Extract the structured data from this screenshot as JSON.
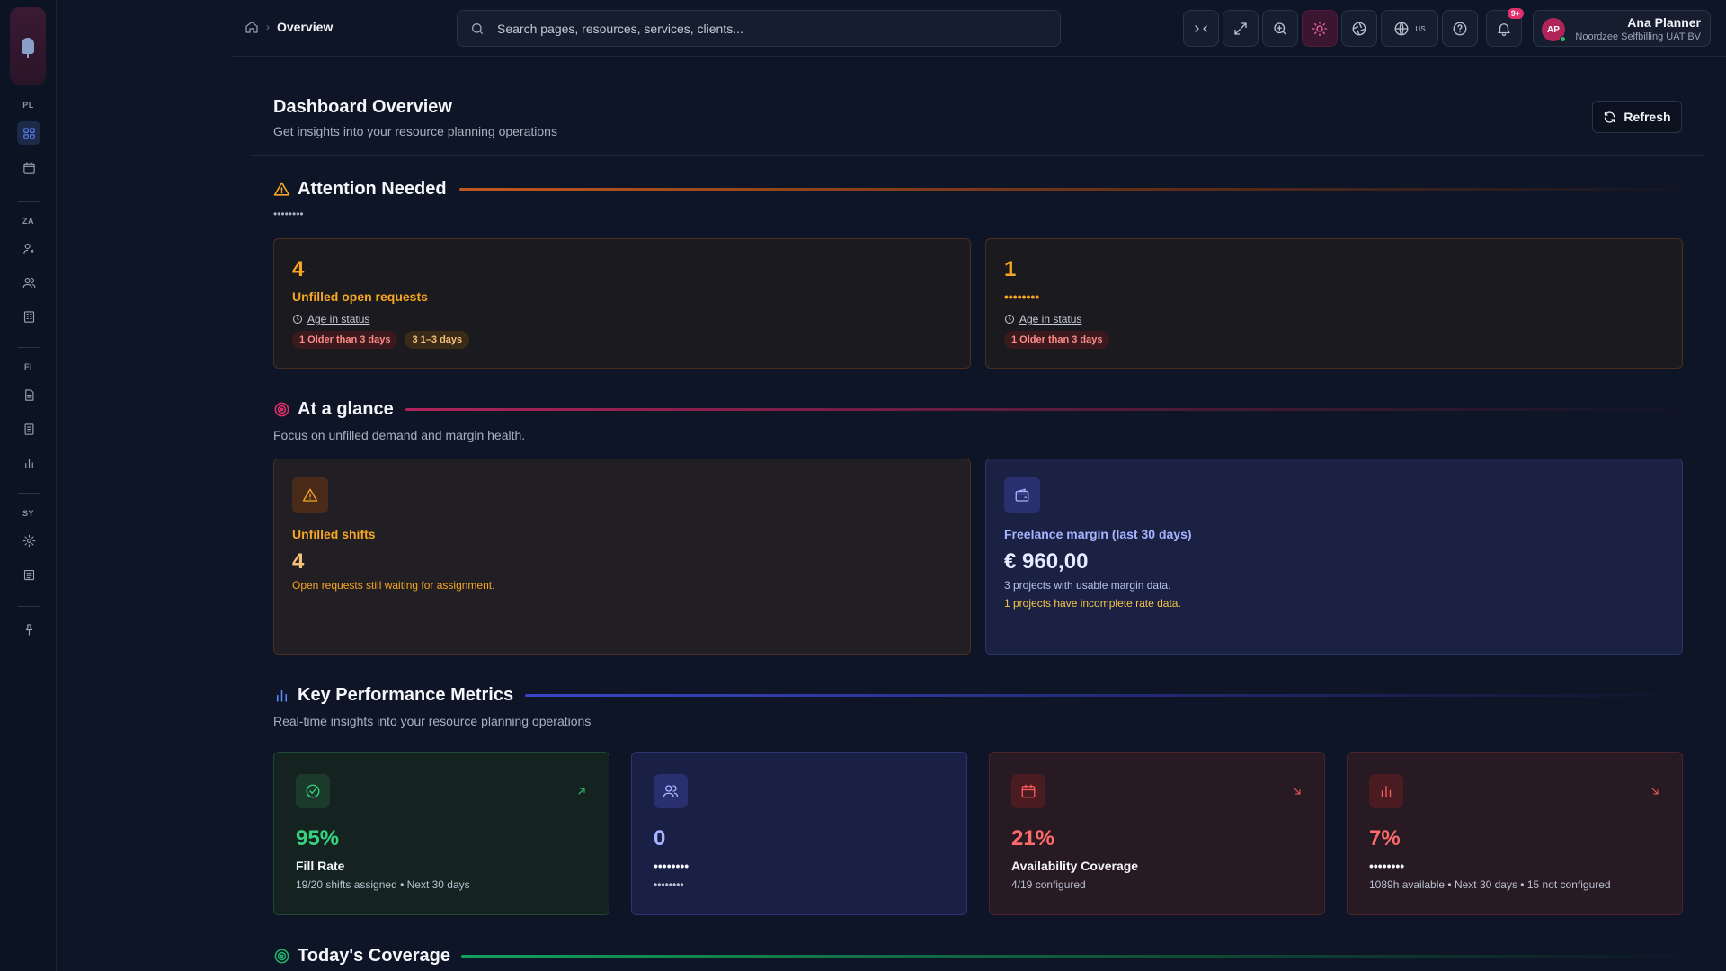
{
  "sidebar": {
    "sections": [
      {
        "label": "PL",
        "items": [
          {
            "icon": "dashboard-icon",
            "active": true
          },
          {
            "icon": "calendar-icon"
          }
        ]
      },
      {
        "label": "ZA",
        "items": [
          {
            "icon": "user-settings-icon"
          },
          {
            "icon": "users-icon"
          },
          {
            "icon": "building-icon"
          }
        ]
      },
      {
        "label": "FI",
        "items": [
          {
            "icon": "document-icon"
          },
          {
            "icon": "receipt-icon"
          },
          {
            "icon": "bar-chart-icon"
          }
        ]
      },
      {
        "label": "SY",
        "items": [
          {
            "icon": "gear-icon"
          },
          {
            "icon": "log-icon"
          }
        ]
      }
    ],
    "pin_icon": "pin-icon"
  },
  "topbar": {
    "breadcrumb": {
      "home_icon": "home-icon",
      "current": "Overview"
    },
    "search": {
      "placeholder": "Search pages, resources, services, clients..."
    },
    "language": "us",
    "notifications_badge": "9+",
    "user": {
      "initials": "AP",
      "name": "Ana Planner",
      "org": "Noordzee Selfbilling UAT BV"
    }
  },
  "header": {
    "title": "Dashboard Overview",
    "subtitle": "Get insights into your resource planning operations",
    "refresh_label": "Refresh"
  },
  "attention": {
    "title": "Attention Needed",
    "description": "••••••••",
    "cards": [
      {
        "count": "4",
        "label": "Unfilled open requests",
        "age_label": "Age in status",
        "pills": [
          {
            "text": "1 Older than 3 days",
            "tone": "red"
          },
          {
            "text": "3 1–3 days",
            "tone": "amber"
          }
        ]
      },
      {
        "count": "1",
        "label": "••••••••",
        "age_label": "Age in status",
        "pills": [
          {
            "text": "1 Older than 3 days",
            "tone": "red"
          }
        ]
      }
    ]
  },
  "glance": {
    "title": "At a glance",
    "description": "Focus on unfilled demand and margin health.",
    "unfilled": {
      "title": "Unfilled shifts",
      "value": "4",
      "note": "Open requests still waiting for assignment."
    },
    "margin": {
      "title": "Freelance margin (last 30 days)",
      "value": "€ 960,00",
      "note1": "3 projects with usable margin data.",
      "note2": "1 projects have incomplete rate data."
    }
  },
  "kpis": {
    "title": "Key Performance Metrics",
    "description": "Real-time insights into your resource planning operations",
    "cards": [
      {
        "value": "95%",
        "label": "Fill Rate",
        "sub": "19/20 shifts assigned • Next 30 days",
        "tone": "green",
        "icon": "check-circle-icon",
        "trend": "up"
      },
      {
        "value": "0",
        "label": "••••••••",
        "sub": "••••••••",
        "tone": "indigo",
        "icon": "users-icon",
        "trend": "none"
      },
      {
        "value": "21%",
        "label": "Availability Coverage",
        "sub": "4/19 configured",
        "tone": "red",
        "icon": "calendar-icon",
        "trend": "down"
      },
      {
        "value": "7%",
        "label": "••••••••",
        "sub": "1089h available • Next 30 days • 15 not configured",
        "tone": "red",
        "icon": "bar-chart-icon",
        "trend": "down"
      }
    ]
  },
  "coverage": {
    "title": "Today's Coverage"
  },
  "colors": {
    "accent": "#5d86ff",
    "warning": "#f6a623",
    "danger": "#ff5b5b",
    "success": "#36d27f",
    "brand": "#e0306c"
  }
}
